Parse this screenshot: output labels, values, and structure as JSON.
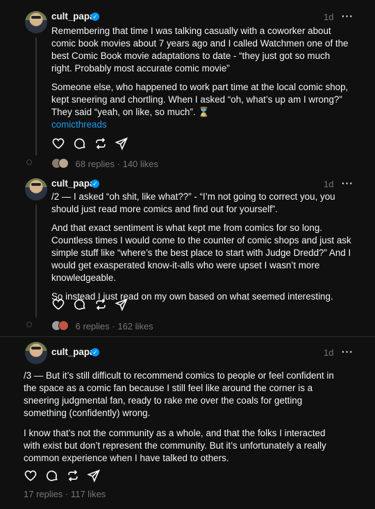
{
  "posts": [
    {
      "username": "cult_papa",
      "time": "1d",
      "more": "···",
      "paragraphs": [
        "Remembering that time I was talking casually with a coworker about comic book movies about 7 years ago and I called Watchmen one of the best Comic Book movie adaptations to date - “they just got so much right. Probably most accurate comic movie”",
        "Someone else, who happened to work part time at the local comic shop, kept sneering and chortling. When I asked “oh, what’s up am I wrong?” They said “yeah, on like, so much”. ⌛"
      ],
      "tag": "comicthreads",
      "replies": "68 replies",
      "likes": "140 likes"
    },
    {
      "username": "cult_papa",
      "time": "1d",
      "more": "···",
      "paragraphs": [
        "/2 — I asked “oh shit, like what??” - “I’m not going to correct you, you should just read more comics and find out for yourself”.",
        "And that exact sentiment is what kept me from comics for so long. Countless times I would come to the counter of comic shops and just ask simple stuff like “where’s the best place to start with Judge Dredd?” And I would get exasperated know-it-alls who were upset I wasn’t more knowledgeable.",
        "So instead I just read on my own based on what seemed interesting."
      ],
      "replies": "6 replies",
      "likes": "162 likes"
    },
    {
      "username": "cult_papa",
      "time": "1d",
      "more": "···",
      "paragraphs": [
        "/3 — But it’s still difficult to recommend comics to people or feel confident in the space as a comic fan because I still feel like around the corner is a sneering judgmental fan, ready to rake me over the coals for getting something (confidently) wrong.",
        "I know that’s not the community as a whole, and that the folks I interacted with exist but don’t represent the community. But it’s unfortunately a really common experience when I have talked to others."
      ],
      "replies": "17 replies",
      "likes": "117 likes"
    }
  ],
  "meta_separator": "·",
  "icons": [
    "heart-icon",
    "comment-icon",
    "repost-icon",
    "share-icon",
    "verified-badge-icon",
    "more-icon"
  ],
  "colors": {
    "background": "#101010",
    "text": "#f3f5f7",
    "muted": "#777777",
    "link": "#1d9bf0",
    "verified": "#0095f6"
  }
}
